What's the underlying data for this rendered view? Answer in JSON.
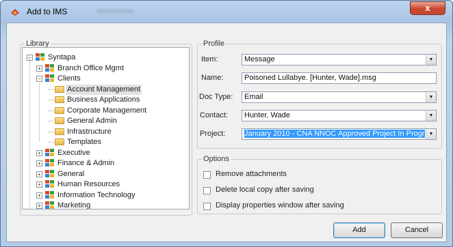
{
  "window": {
    "title": "Add to IMS",
    "close_label": "x",
    "colors": {
      "accent_selection": "#3399ff",
      "close_button": "#c9462c"
    }
  },
  "library": {
    "legend": "Library",
    "tree": [
      {
        "label": "Syntapa",
        "icon": "group-icon",
        "expander": "minus"
      },
      {
        "label": "Branch Office Mgmt",
        "icon": "group-icon",
        "expander": "plus"
      },
      {
        "label": "Clients",
        "icon": "group-icon",
        "expander": "minus"
      },
      {
        "label": "Account Management",
        "icon": "folder-icon",
        "selected": true
      },
      {
        "label": "Business Applications",
        "icon": "folder-icon"
      },
      {
        "label": "Corporate Management",
        "icon": "folder-icon"
      },
      {
        "label": "General Admin",
        "icon": "folder-icon"
      },
      {
        "label": "Infrastructure",
        "icon": "folder-icon"
      },
      {
        "label": "Templates",
        "icon": "folder-icon"
      },
      {
        "label": "Executive",
        "icon": "group-icon",
        "expander": "plus"
      },
      {
        "label": "Finance & Admin",
        "icon": "group-icon",
        "expander": "plus"
      },
      {
        "label": "General",
        "icon": "group-icon",
        "expander": "plus"
      },
      {
        "label": "Human Resources",
        "icon": "group-icon",
        "expander": "plus"
      },
      {
        "label": "Information Technology",
        "icon": "group-icon",
        "expander": "plus"
      },
      {
        "label": "Marketing",
        "icon": "group-icon",
        "expander": "plus"
      }
    ]
  },
  "profile": {
    "legend": "Profile",
    "item_label": "Item:",
    "item_value": "Message",
    "name_label": "Name:",
    "name_value": "Poisoned Lullabye. [Hunter, Wade].msg",
    "doctype_label": "Doc Type:",
    "doctype_value": "Email",
    "contact_label": "Contact:",
    "contact_value": "Hunter, Wade",
    "project_label": "Project:",
    "project_value": "January 2010 - CNA NNOC Approved Project In Progr"
  },
  "options": {
    "legend": "Options",
    "checkboxes": [
      {
        "label": "Remove attachments",
        "checked": false
      },
      {
        "label": "Delete local copy after saving",
        "checked": false
      },
      {
        "label": "Display properties window after saving",
        "checked": false
      }
    ]
  },
  "buttons": {
    "add": "Add",
    "cancel": "Cancel"
  }
}
